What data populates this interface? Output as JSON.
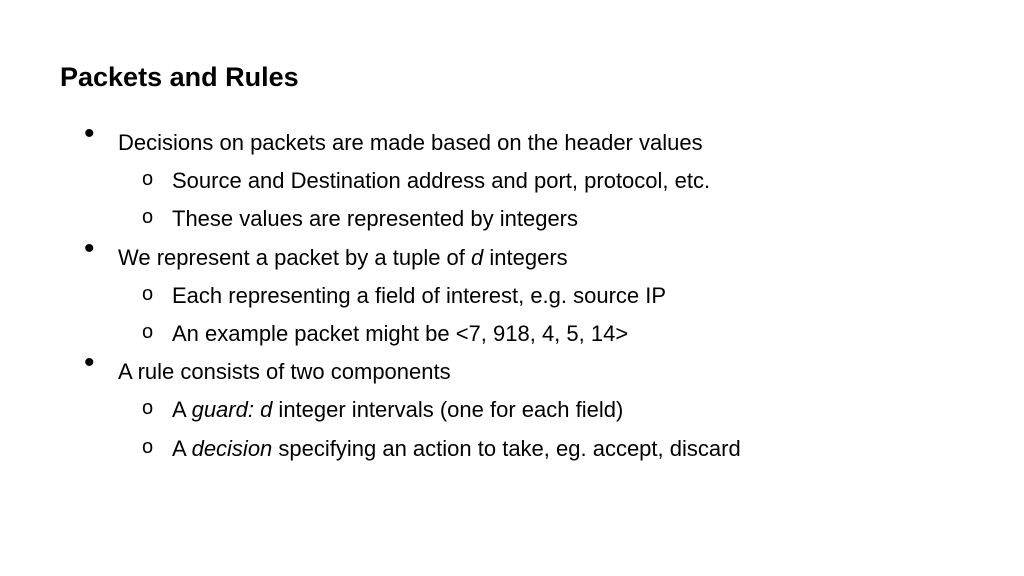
{
  "title": "Packets and Rules",
  "bullets": {
    "b1": {
      "text": "Decisions on packets are made based on the header values",
      "sub1": "Source and Destination address and port, protocol, etc.",
      "sub2": "These values are represented by integers"
    },
    "b2": {
      "prefix": "We represent a packet by a tuple of ",
      "italic": "d",
      "suffix": " integers",
      "sub1": "Each representing a field of interest, e.g. source IP",
      "sub2": "An example packet might be <7, 918, 4, 5, 14>"
    },
    "b3": {
      "text": "A rule consists of two components",
      "sub1_prefix": "A ",
      "sub1_italic": "guard: d",
      "sub1_suffix": " integer intervals (one for each field)",
      "sub2_prefix": "A ",
      "sub2_italic": "decision",
      "sub2_suffix": " specifying an action to take, eg. accept, discard"
    }
  }
}
